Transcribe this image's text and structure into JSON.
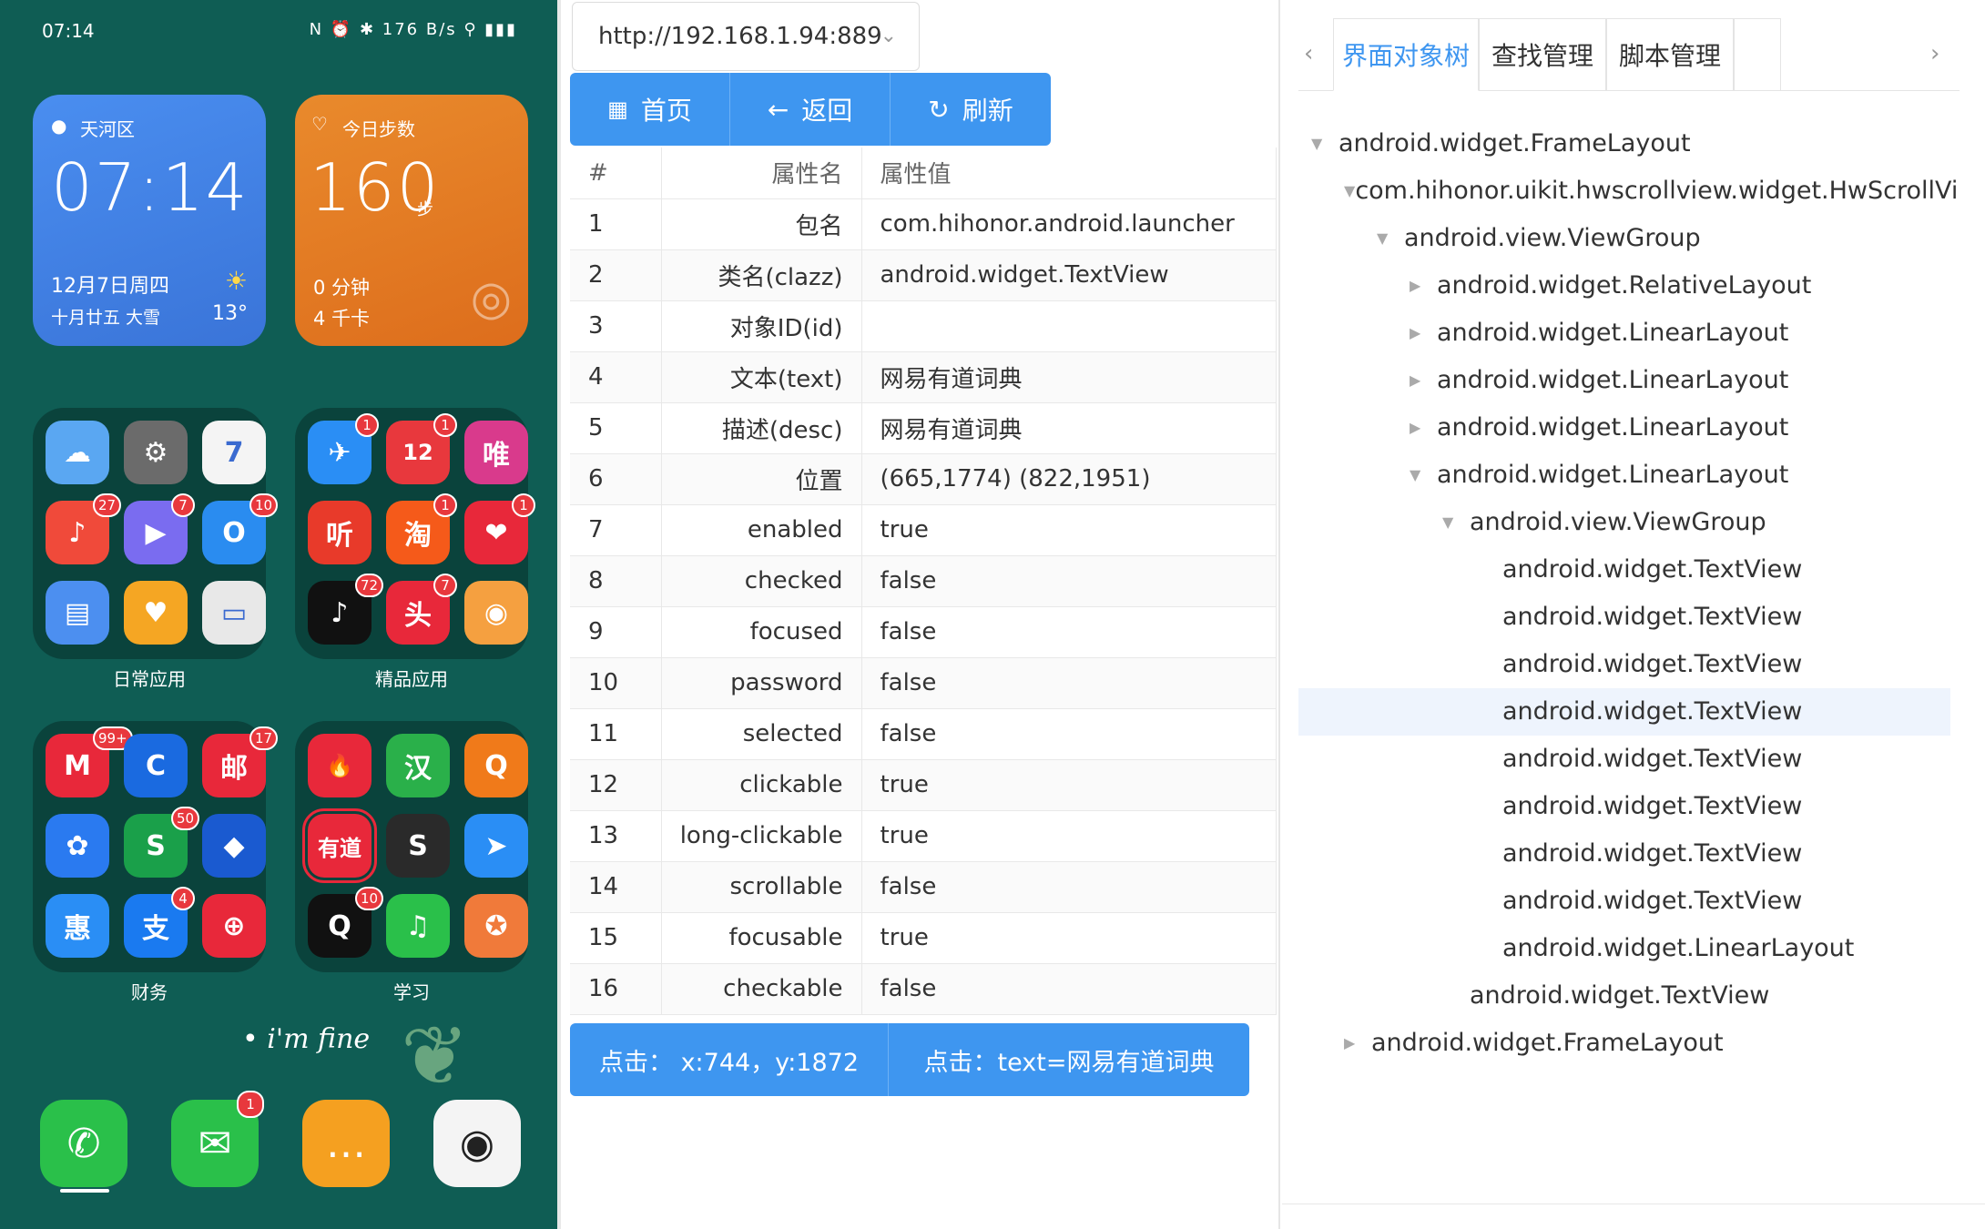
{
  "phone": {
    "time": "07:14",
    "status_right": "N ⏰ ✱ 176 B/s ⚲ ▮▮▮",
    "weather": {
      "location": "天河区",
      "time": "07:14",
      "date": "12月7日周四",
      "lunar": "十月廿五  大雪",
      "temp": "13°"
    },
    "steps": {
      "title": "今日步数",
      "count": "160",
      "unit": "步",
      "minutes": "0 分钟",
      "kcal": "4 千卡"
    },
    "folders": [
      {
        "label": "日常应用",
        "apps": [
          {
            "glyph": "☁",
            "color": "#5aa7f2",
            "badge": ""
          },
          {
            "glyph": "⚙",
            "color": "#6b6b6b",
            "badge": ""
          },
          {
            "glyph": "7",
            "color": "#f4f4f4",
            "badge": ""
          },
          {
            "glyph": "♪",
            "color": "#f04a3a",
            "badge": "27"
          },
          {
            "glyph": "▶",
            "color": "#7a6cf0",
            "badge": "7"
          },
          {
            "glyph": "O",
            "color": "#2a8cf0",
            "badge": "10"
          },
          {
            "glyph": "▤",
            "color": "#4c8ff0",
            "badge": ""
          },
          {
            "glyph": "♥",
            "color": "#f5a623",
            "badge": ""
          },
          {
            "glyph": "▭",
            "color": "#e8e8e8",
            "badge": ""
          }
        ]
      },
      {
        "label": "精品应用",
        "apps": [
          {
            "glyph": "✈",
            "color": "#2a8ef5",
            "badge": "1"
          },
          {
            "glyph": "12",
            "color": "#e8383d",
            "badge": "1"
          },
          {
            "glyph": "唯",
            "color": "#d93a8c",
            "badge": ""
          },
          {
            "glyph": "听",
            "color": "#e83a2a",
            "badge": ""
          },
          {
            "glyph": "淘",
            "color": "#f55a1a",
            "badge": "1"
          },
          {
            "glyph": "❤",
            "color": "#e8283a",
            "badge": "1"
          },
          {
            "glyph": "♪",
            "color": "#111111",
            "badge": "72"
          },
          {
            "glyph": "头",
            "color": "#e8283a",
            "badge": "7"
          },
          {
            "glyph": "◉",
            "color": "#f5a040",
            "badge": ""
          }
        ]
      },
      {
        "label": "财务",
        "apps": [
          {
            "glyph": "M",
            "color": "#e8283a",
            "badge": "99+"
          },
          {
            "glyph": "C",
            "color": "#1a6ae0",
            "badge": ""
          },
          {
            "glyph": "邮",
            "color": "#e8283a",
            "badge": "17"
          },
          {
            "glyph": "✿",
            "color": "#2a7af0",
            "badge": ""
          },
          {
            "glyph": "S",
            "color": "#1aa04a",
            "badge": "50"
          },
          {
            "glyph": "◆",
            "color": "#1a5ad0",
            "badge": ""
          },
          {
            "glyph": "惠",
            "color": "#2a8ef5",
            "badge": ""
          },
          {
            "glyph": "支",
            "color": "#1a7af0",
            "badge": "4"
          },
          {
            "glyph": "⊕",
            "color": "#e8283a",
            "badge": ""
          }
        ]
      },
      {
        "label": "学习",
        "apps": [
          {
            "glyph": "🔥",
            "color": "#e8283a",
            "badge": ""
          },
          {
            "glyph": "汉",
            "color": "#2ab04a",
            "badge": ""
          },
          {
            "glyph": "Q",
            "color": "#f07a1a",
            "badge": ""
          },
          {
            "glyph": "有道",
            "color": "#e8283a",
            "badge": ""
          },
          {
            "glyph": "S",
            "color": "#2a2a2a",
            "badge": ""
          },
          {
            "glyph": "➤",
            "color": "#2a8ef5",
            "badge": ""
          },
          {
            "glyph": "Q",
            "color": "#111111",
            "badge": "10"
          },
          {
            "glyph": "♫",
            "color": "#2ac04a",
            "badge": ""
          },
          {
            "glyph": "✪",
            "color": "#f07a3a",
            "badge": ""
          }
        ]
      }
    ],
    "slogan": "• i'm fine",
    "dock": [
      {
        "glyph": "✆",
        "color": "#2ac04a",
        "badge": ""
      },
      {
        "glyph": "✉",
        "color": "#2ac04a",
        "badge": "1"
      },
      {
        "glyph": "…",
        "color": "#f5a020",
        "badge": ""
      },
      {
        "glyph": "◉",
        "color": "#f4f4f4",
        "badge": ""
      }
    ]
  },
  "inspector": {
    "url": "http://192.168.1.94:889",
    "nav": {
      "home": "首页",
      "back": "返回",
      "refresh": "刷新"
    },
    "headers": {
      "index": "#",
      "name": "属性名",
      "value": "属性值"
    },
    "rows": [
      {
        "i": "1",
        "name": "包名",
        "value": "com.hihonor.android.launcher"
      },
      {
        "i": "2",
        "name": "类名(clazz)",
        "value": "android.widget.TextView"
      },
      {
        "i": "3",
        "name": "对象ID(id)",
        "value": ""
      },
      {
        "i": "4",
        "name": "文本(text)",
        "value": "网易有道词典"
      },
      {
        "i": "5",
        "name": "描述(desc)",
        "value": "网易有道词典"
      },
      {
        "i": "6",
        "name": "位置",
        "value": "(665,1774) (822,1951)"
      },
      {
        "i": "7",
        "name": "enabled",
        "value": "true"
      },
      {
        "i": "8",
        "name": "checked",
        "value": "false"
      },
      {
        "i": "9",
        "name": "focused",
        "value": "false"
      },
      {
        "i": "10",
        "name": "password",
        "value": "false"
      },
      {
        "i": "11",
        "name": "selected",
        "value": "false"
      },
      {
        "i": "12",
        "name": "clickable",
        "value": "true"
      },
      {
        "i": "13",
        "name": "long-clickable",
        "value": "true"
      },
      {
        "i": "14",
        "name": "scrollable",
        "value": "false"
      },
      {
        "i": "15",
        "name": "focusable",
        "value": "true"
      },
      {
        "i": "16",
        "name": "checkable",
        "value": "false"
      }
    ],
    "click_xy": "点击：  x:744，y:1872",
    "click_text": "点击：text=网易有道词典"
  },
  "tree_panel": {
    "tabs": [
      "界面对象树",
      "查找管理",
      "脚本管理"
    ],
    "active_tab": 0,
    "nodes": [
      {
        "label": "android.widget.FrameLayout",
        "depth": 0,
        "toggle": "open"
      },
      {
        "label": "com.hihonor.uikit.hwscrollview.widget.HwScrollView",
        "depth": 1,
        "toggle": "open"
      },
      {
        "label": "android.view.ViewGroup",
        "depth": 2,
        "toggle": "open"
      },
      {
        "label": "android.widget.RelativeLayout",
        "depth": 3,
        "toggle": "closed"
      },
      {
        "label": "android.widget.LinearLayout",
        "depth": 3,
        "toggle": "closed"
      },
      {
        "label": "android.widget.LinearLayout",
        "depth": 3,
        "toggle": "closed"
      },
      {
        "label": "android.widget.LinearLayout",
        "depth": 3,
        "toggle": "closed"
      },
      {
        "label": "android.widget.LinearLayout",
        "depth": 3,
        "toggle": "open"
      },
      {
        "label": "android.view.ViewGroup",
        "depth": 4,
        "toggle": "open"
      },
      {
        "label": "android.widget.TextView",
        "depth": 5,
        "toggle": ""
      },
      {
        "label": "android.widget.TextView",
        "depth": 5,
        "toggle": ""
      },
      {
        "label": "android.widget.TextView",
        "depth": 5,
        "toggle": ""
      },
      {
        "label": "android.widget.TextView",
        "depth": 5,
        "toggle": "",
        "selected": true
      },
      {
        "label": "android.widget.TextView",
        "depth": 5,
        "toggle": ""
      },
      {
        "label": "android.widget.TextView",
        "depth": 5,
        "toggle": ""
      },
      {
        "label": "android.widget.TextView",
        "depth": 5,
        "toggle": ""
      },
      {
        "label": "android.widget.TextView",
        "depth": 5,
        "toggle": ""
      },
      {
        "label": "android.widget.LinearLayout",
        "depth": 5,
        "toggle": ""
      },
      {
        "label": "android.widget.TextView",
        "depth": 4,
        "toggle": ""
      },
      {
        "label": "android.widget.FrameLayout",
        "depth": 1,
        "toggle": "closed"
      }
    ]
  },
  "colors": {
    "accent": "#3e96f0",
    "phone_bg": "#0f5d54",
    "highlight": "#e8283a"
  }
}
